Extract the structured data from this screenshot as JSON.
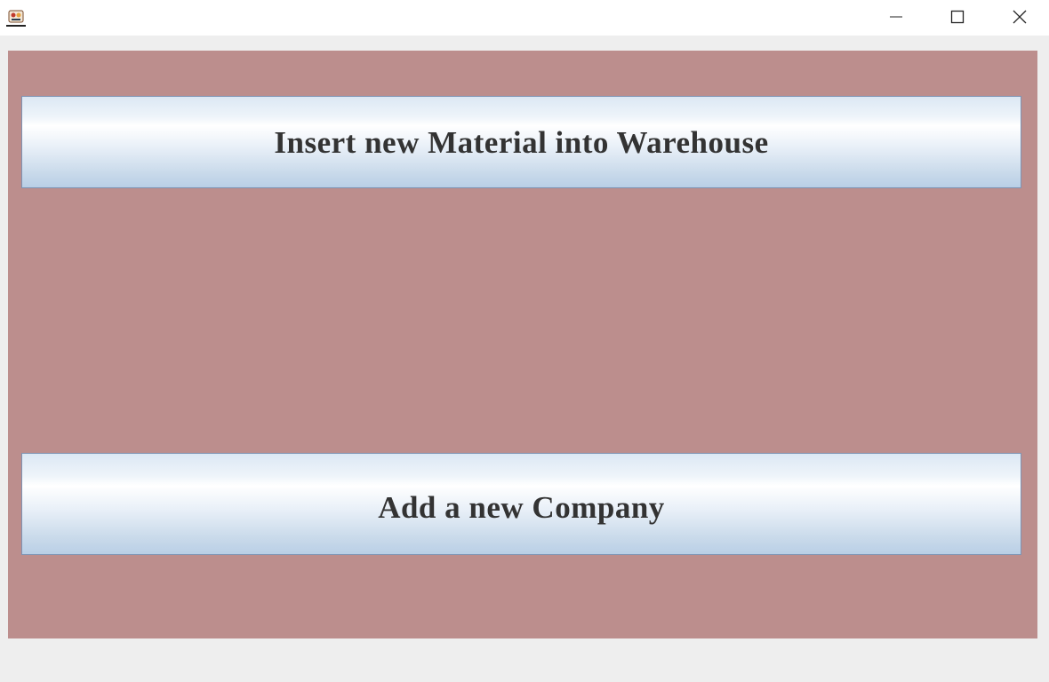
{
  "window": {
    "title": "",
    "controls": {
      "minimize": "minimize-icon",
      "maximize": "maximize-icon",
      "close": "close-icon"
    },
    "app_icon": "app-icon"
  },
  "main": {
    "background_color": "#bc8e8d",
    "buttons": [
      {
        "label": "Insert new Material into Warehouse"
      },
      {
        "label": "Add a new Company"
      }
    ]
  }
}
